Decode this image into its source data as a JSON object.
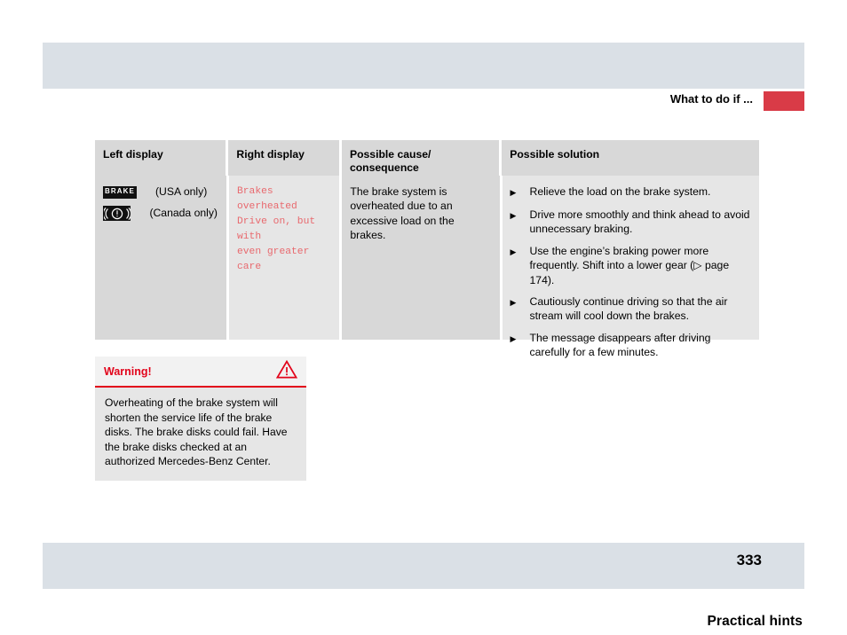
{
  "header": {
    "title": "Practical hints",
    "subtitle": "What to do if ...",
    "marker_color": "#d93b47",
    "bar_color": "#dae0e6"
  },
  "table": {
    "columns": [
      {
        "label": "Left display"
      },
      {
        "label": "Right display"
      },
      {
        "label": "Possible cause/\nconsequence"
      },
      {
        "label": "Possible solution"
      }
    ],
    "rows": [
      {
        "left_display": {
          "indicators": [
            {
              "icon": "brake-telltale-icon",
              "icon_text": "BRAKE",
              "variant": "(USA only)"
            },
            {
              "icon": "brake-circle-telltale-icon",
              "icon_text": "",
              "variant": "(Canada only)"
            }
          ]
        },
        "right_display": {
          "message": "Brakes overheated\nDrive on, but with\neven greater care",
          "text_color": "#e8696e"
        },
        "possible_cause": "The brake system is overheated due to an excessive load on the brakes.",
        "possible_solution": [
          "Relieve the load on the brake system.",
          "Drive more smoothly and think ahead to avoid unnecessary braking.",
          "Use the engine’s braking power more frequently. Shift into a lower gear (▷ page 174).",
          "Cautiously continue driving so that the air stream will cool down the brakes.",
          "The message disappears after driving carefully for a few minutes."
        ]
      }
    ]
  },
  "warning": {
    "title": "Warning!",
    "icon": "warning-triangle-icon",
    "accent_color": "#e2041b",
    "body": "Overheating of the brake system will shorten the service life of the brake disks. The brake disks could fail. Have the brake disks checked at an authorized Mercedes-Benz Center."
  },
  "footer": {
    "page_number": "333",
    "bar_color": "#dae0e6"
  }
}
